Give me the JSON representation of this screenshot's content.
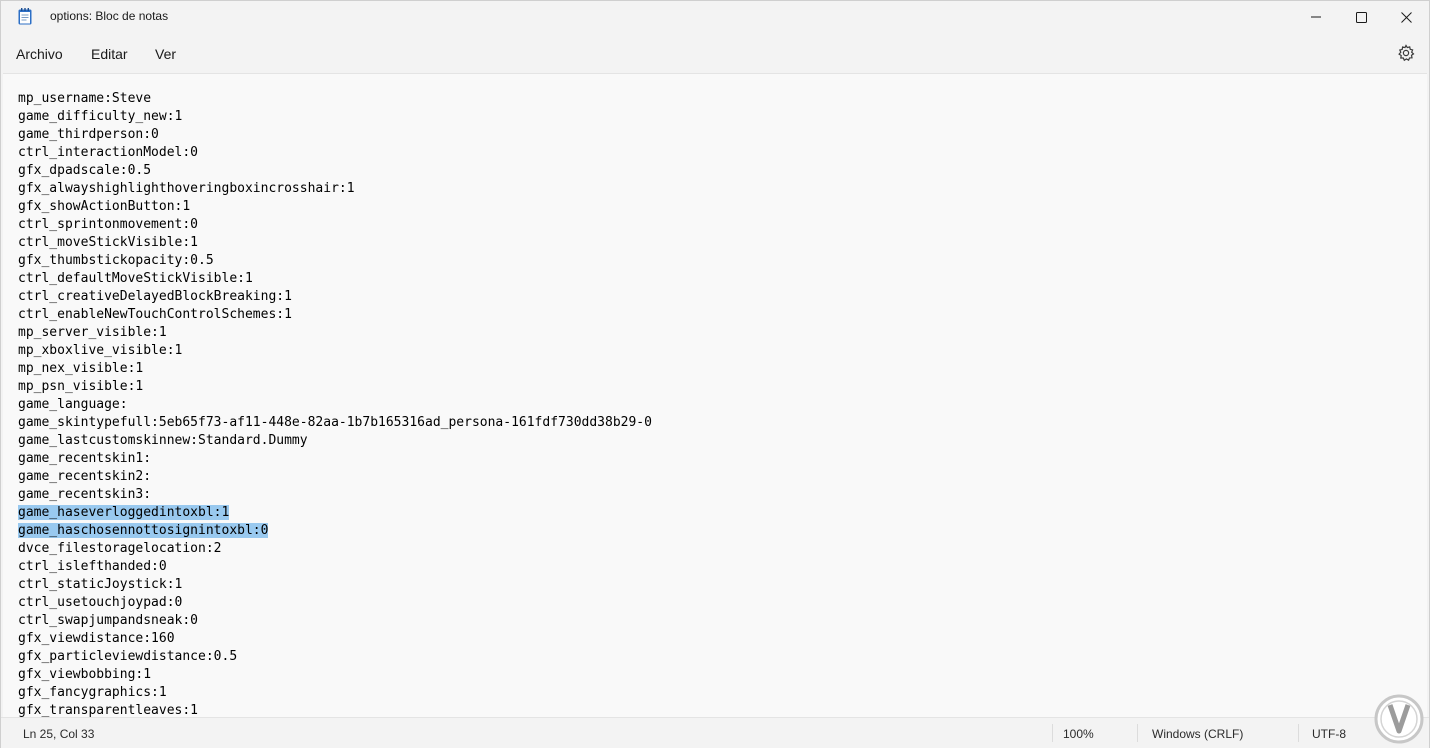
{
  "window": {
    "title": "options: Bloc de notas",
    "icon": "notepad-icon",
    "controls": [
      "minimize-icon",
      "maximize-icon",
      "close-icon"
    ]
  },
  "menu": {
    "items": [
      "Archivo",
      "Editar",
      "Ver"
    ],
    "settings_icon": "gear-icon"
  },
  "editor": {
    "lines": [
      "mp_username:Steve",
      "game_difficulty_new:1",
      "game_thirdperson:0",
      "ctrl_interactionModel:0",
      "gfx_dpadscale:0.5",
      "gfx_alwayshighlighthoveringboxincrosshair:1",
      "gfx_showActionButton:1",
      "ctrl_sprintonmovement:0",
      "ctrl_moveStickVisible:1",
      "gfx_thumbstickopacity:0.5",
      "ctrl_defaultMoveStickVisible:1",
      "ctrl_creativeDelayedBlockBreaking:1",
      "ctrl_enableNewTouchControlSchemes:1",
      "mp_server_visible:1",
      "mp_xboxlive_visible:1",
      "mp_nex_visible:1",
      "mp_psn_visible:1",
      "game_language:",
      "game_skintypefull:5eb65f73-af11-448e-82aa-1b7b165316ad_persona-161fdf730dd38b29-0",
      "game_lastcustomskinnew:Standard.Dummy",
      "game_recentskin1:",
      "game_recentskin2:",
      "game_recentskin3:",
      "game_haseverloggedintoxbl:1",
      "game_haschosennottosignintoxbl:0",
      "dvce_filestoragelocation:2",
      "ctrl_islefthanded:0",
      "ctrl_staticJoystick:1",
      "ctrl_usetouchjoypad:0",
      "ctrl_swapjumpandsneak:0",
      "gfx_viewdistance:160",
      "gfx_particleviewdistance:0.5",
      "gfx_viewbobbing:1",
      "gfx_fancygraphics:1",
      "gfx_transparentleaves:1"
    ],
    "selected_lines": [
      23,
      24
    ],
    "selection_color": "#99c9ef"
  },
  "status": {
    "position": "Ln 25, Col 33",
    "zoom": "100%",
    "line_ending": "Windows (CRLF)",
    "encoding": "UTF-8"
  },
  "watermark_icon": "solvetic-logo-icon"
}
